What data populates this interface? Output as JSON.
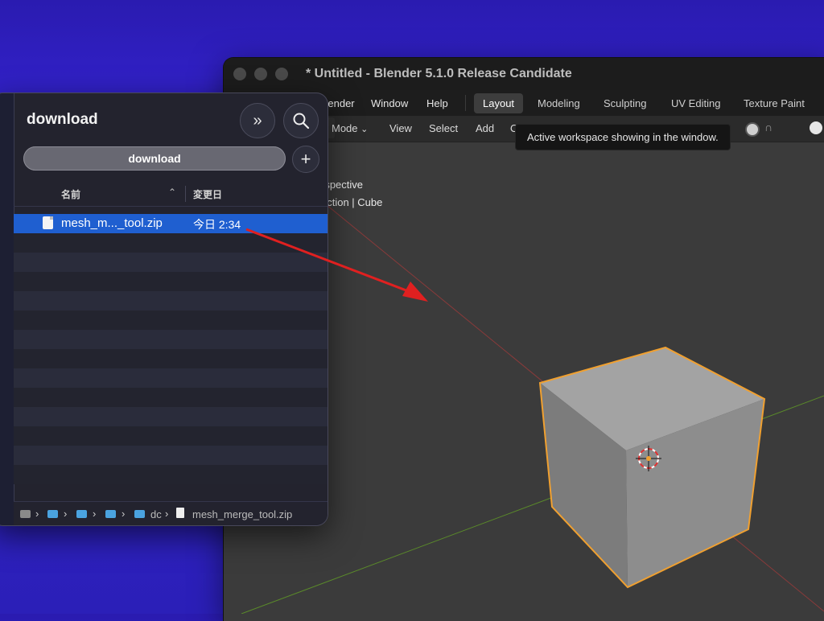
{
  "blender": {
    "title": "* Untitled - Blender 5.1.0 Release Candidate",
    "menu": [
      "Render",
      "Window",
      "Help"
    ],
    "workspaces": [
      "Layout",
      "Modeling",
      "Sculpting",
      "UV Editing",
      "Texture Paint"
    ],
    "header": {
      "mode": "Mode",
      "items": [
        "View",
        "Select",
        "Add",
        "O"
      ]
    },
    "tooltip": "Active workspace showing in the window.",
    "viewport": {
      "line1": "rspective",
      "line2": "ection | Cube"
    }
  },
  "finder": {
    "title": "download",
    "path_button": "download",
    "columns": {
      "name": "名前",
      "date": "変更日"
    },
    "files": [
      {
        "name": "mesh_m..._tool.zip",
        "date": "今日 2:34",
        "selected": true
      }
    ],
    "statusbar": {
      "partial": "dc",
      "filename": "mesh_merge_tool.zip"
    }
  },
  "colors": {
    "desktop": "#2f22c4",
    "selection": "#1f5fd0",
    "arrow": "#e02020",
    "cube_outline": "#f0a030"
  }
}
